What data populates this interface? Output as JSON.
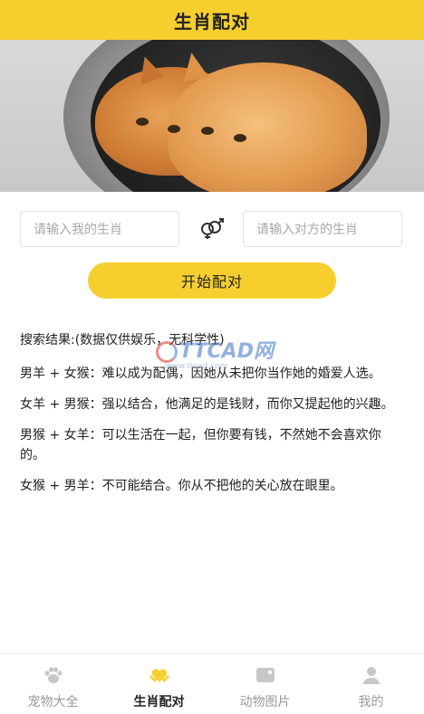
{
  "header": {
    "title": "生肖配对"
  },
  "inputs": {
    "mine_placeholder": "请输入我的生肖",
    "gender_icon": "gender-male-female-icon",
    "other_placeholder": "请输入对方的生肖"
  },
  "actions": {
    "match_label": "开始配对"
  },
  "results": {
    "heading": "搜索结果:(数据仅供娱乐，无科学性)",
    "items": [
      "男羊 + 女猴：难以成为配偶，因她从未把你当作她的婚爱人选。",
      "女羊 + 男猴：强以结合，他满足的是钱财，而你又提起他的兴趣。",
      "男猴 + 女羊：可以生活在一起，但你要有钱，不然她不会喜欢你的。",
      "女猴 + 男羊：不可能结合。你从不把他的关心放在眼里。"
    ]
  },
  "watermark": {
    "text": "TTCAD网",
    "sub": "www.ttcad.com"
  },
  "tabbar": {
    "items": [
      {
        "label": "宠物大全",
        "icon": "paw-icon",
        "active": false
      },
      {
        "label": "生肖配对",
        "icon": "heart-hands-icon",
        "active": true
      },
      {
        "label": "动物图片",
        "icon": "image-icon",
        "active": false
      },
      {
        "label": "我的",
        "icon": "user-icon",
        "active": false
      }
    ]
  },
  "colors": {
    "accent": "#f6cf2f",
    "inactive_tab": "#9a9a9a"
  }
}
